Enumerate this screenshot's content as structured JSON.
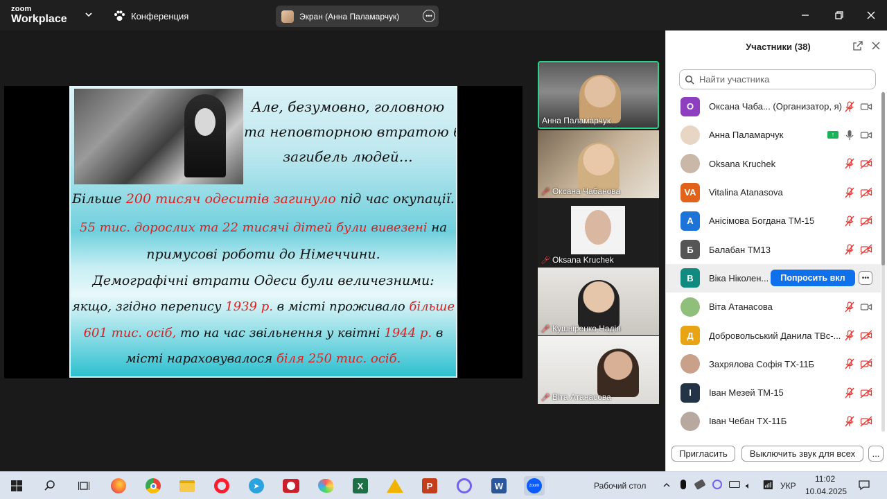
{
  "app": {
    "logo_line1": "zoom",
    "logo_line2": "Workplace",
    "meeting_label": "Конференция",
    "share_pill": "Экран (Анна Паламарчук)"
  },
  "slide": {
    "heading": [
      "Але, безумовно, головною",
      "та неповторною втратою була",
      "загибель людей…"
    ],
    "line1": {
      "a": "Більше ",
      "b": "200 тисяч одеситів загинуло",
      "c": " під час окупації."
    },
    "line2": {
      "a": "55 тис. дорослих та 22 тисячі дітей були вивезені",
      "b": " на"
    },
    "line3": "примусові роботи до Німеччини.",
    "line4": "Демографічні втрати Одеси були величезними:",
    "line5": {
      "a": "якщо, згідно перепису ",
      "b": "1939 р.",
      "c": " в місті проживало ",
      "d": "більше"
    },
    "line6": {
      "a": "601 тис. осіб,",
      "b": " то на час звільнення у квітні ",
      "c": "1944 р.",
      "d": " в"
    },
    "line7": {
      "a": "місті нараховувалося ",
      "b": "біля 250 тис. осіб."
    }
  },
  "videos": [
    {
      "name": "Анна Паламарчук",
      "muted": false
    },
    {
      "name": "Оксана Чабанова",
      "muted": true
    },
    {
      "name": "Oksana Kruchek",
      "muted": true
    },
    {
      "name": "Кушніренко Надія",
      "muted": true
    },
    {
      "name": "Віта Атанасова",
      "muted": true
    }
  ],
  "panel": {
    "title": "Участники (38)",
    "search_placeholder": "Найти участника",
    "ask_unmute": "Попросить вкл",
    "invite": "Пригласить",
    "mute_all": "Выключить звук для всех",
    "more": "..."
  },
  "participants": [
    {
      "name": "Оксана Чаба... (Организатор, я)",
      "initials": "O",
      "color": "#8e3fbf",
      "mic": "muted",
      "cam": "on"
    },
    {
      "name": "Анна Паламарчук",
      "initials": "",
      "color": "#e8d6c4",
      "mic": "on",
      "cam": "on",
      "share": true
    },
    {
      "name": "Oksana Kruchek",
      "initials": "",
      "color": "#c9b7a8",
      "mic": "muted",
      "cam": "off"
    },
    {
      "name": "Vitalina Atanasova",
      "initials": "VA",
      "color": "#e0621b",
      "mic": "muted",
      "cam": "off"
    },
    {
      "name": "Анісімова Богдана ТМ-15",
      "initials": "А",
      "color": "#1d74d8",
      "mic": "muted",
      "cam": "off"
    },
    {
      "name": "Балабан ТМ13",
      "initials": "Б",
      "color": "#555555",
      "mic": "muted",
      "cam": "off"
    },
    {
      "name": "Віка Ніколен...",
      "initials": "В",
      "color": "#118a80",
      "mic": "",
      "cam": "",
      "hover": true
    },
    {
      "name": "Віта Атанасова",
      "initials": "",
      "color": "#8fbf7a",
      "mic": "muted",
      "cam": "on"
    },
    {
      "name": "Добровольський Данила ТВс-...",
      "initials": "Д",
      "color": "#e8a412",
      "mic": "muted",
      "cam": "off"
    },
    {
      "name": "Захрялова Софія ТХ-11Б",
      "initials": "",
      "color": "#c9a08a",
      "mic": "muted",
      "cam": "off"
    },
    {
      "name": "Іван Мезей ТМ-15",
      "initials": "І",
      "color": "#243447",
      "mic": "muted",
      "cam": "off"
    },
    {
      "name": "Іван Чебан ТХ-11Б",
      "initials": "",
      "color": "#b8a9a0",
      "mic": "muted",
      "cam": "off"
    }
  ],
  "taskbar": {
    "desktop_label": "Рабочий стол",
    "lang": "УКР",
    "time": "11:02",
    "date": "10.04.2025"
  }
}
